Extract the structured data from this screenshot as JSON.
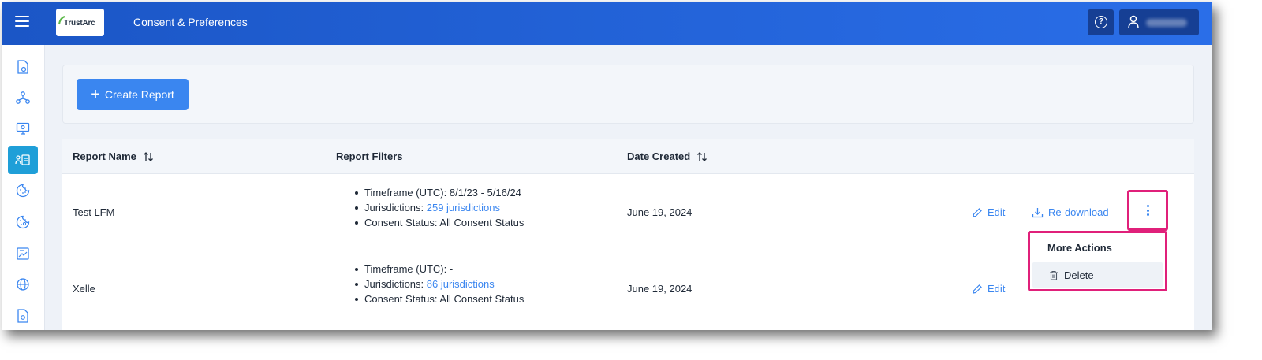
{
  "header": {
    "logo_text": "TrustArc",
    "app_title": "Consent & Preferences"
  },
  "sidebar": {
    "items": [
      {
        "icon": "report-document-icon",
        "active": false
      },
      {
        "icon": "hierarchy-icon",
        "active": false
      },
      {
        "icon": "monitor-icon",
        "active": false
      },
      {
        "icon": "reports-icon",
        "active": true
      },
      {
        "icon": "cookie-icon",
        "active": false
      },
      {
        "icon": "cookie-settings-icon",
        "active": false
      },
      {
        "icon": "image-report-icon",
        "active": false
      },
      {
        "icon": "globe-icon",
        "active": false
      },
      {
        "icon": "document-icon",
        "active": false
      }
    ]
  },
  "toolbar": {
    "create_label": "Create Report"
  },
  "table": {
    "columns": {
      "name": "Report Name",
      "filters": "Report Filters",
      "date": "Date Created"
    },
    "rows": [
      {
        "name": "Test LFM",
        "filters": {
          "timeframe": "Timeframe (UTC): 8/1/23 - 5/16/24",
          "jurisdictions_label": "Jurisdictions: ",
          "jurisdictions_link": "259 jurisdictions",
          "consent": "Consent Status: All Consent Status"
        },
        "date": "June 19, 2024",
        "edit_label": "Edit",
        "redownload_label": "Re-download"
      },
      {
        "name": "Xelle",
        "filters": {
          "timeframe": "Timeframe (UTC): -",
          "jurisdictions_label": "Jurisdictions: ",
          "jurisdictions_link": "86 jurisdictions",
          "consent": "Consent Status: All Consent Status"
        },
        "date": "June 19, 2024",
        "edit_label": "Edit"
      }
    ]
  },
  "more_actions": {
    "title": "More Actions",
    "delete_label": "Delete"
  },
  "colors": {
    "header_blue": "#1b56c6",
    "accent_blue": "#3a86f0",
    "active_sidebar": "#1f9fd8",
    "highlight_pink": "#e0207a"
  }
}
